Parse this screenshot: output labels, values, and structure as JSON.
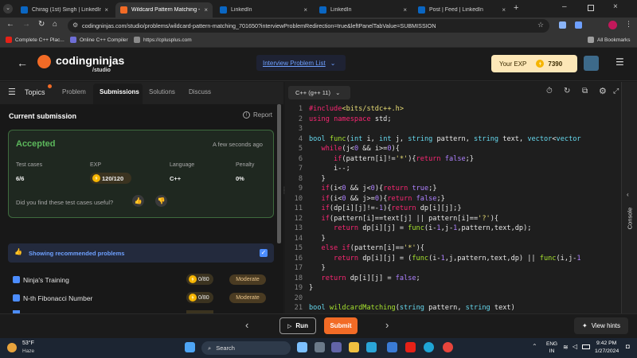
{
  "browser": {
    "tabs": [
      {
        "title": "Chirag (1st) Singh | LinkedIn",
        "active": false
      },
      {
        "title": "Wildcard Pattern Matching - Co",
        "active": true
      },
      {
        "title": "LinkedIn",
        "active": false
      },
      {
        "title": "LinkedIn",
        "active": false
      },
      {
        "title": "Post | Feed | LinkedIn",
        "active": false
      }
    ],
    "url": "codingninjas.com/studio/problems/wildcard-pattern-matching_701650?interviewProblemRedirection=true&leftPanelTabValue=SUBMISSION",
    "bookmarks": [
      "Complete C++ Plac...",
      "Online C++ Compiler",
      "https://cplusplus.com"
    ],
    "all_bookmarks": "All Bookmarks"
  },
  "header": {
    "logo_main": "codingninjas",
    "logo_sub": "/studio",
    "interview_list": "Interview Problem List",
    "exp_label": "Your EXP",
    "exp_value": "7390"
  },
  "left_tabs": {
    "topics": "Topics",
    "problem": "Problem",
    "submissions": "Submissions",
    "solutions": "Solutions",
    "discuss": "Discuss"
  },
  "submission": {
    "title": "Current submission",
    "report": "Report",
    "status": "Accepted",
    "time": "A few seconds ago",
    "test_cases_label": "Test cases",
    "test_cases_value": "6/6",
    "exp_label": "EXP",
    "exp_value": "120/120",
    "language_label": "Language",
    "language_value": "C++",
    "penalty_label": "Penalty",
    "penalty_value": "0%",
    "feedback_question": "Did you find these test cases useful?"
  },
  "recommended": {
    "label": "Showing recommended problems",
    "problems": [
      {
        "name": "Ninja's Training",
        "exp": "0/80",
        "difficulty": "Moderate"
      },
      {
        "name": "N-th Fibonacci Number",
        "exp": "0/80",
        "difficulty": "Moderate"
      }
    ]
  },
  "editor": {
    "language": "C++ (g++ 11)",
    "lines": [
      {
        "n": "1"
      },
      {
        "n": "2"
      },
      {
        "n": "3"
      },
      {
        "n": "4"
      },
      {
        "n": "5"
      },
      {
        "n": "6"
      },
      {
        "n": "7"
      },
      {
        "n": "8"
      },
      {
        "n": "9"
      },
      {
        "n": "10"
      },
      {
        "n": "11"
      },
      {
        "n": "12"
      },
      {
        "n": "13"
      },
      {
        "n": "14"
      },
      {
        "n": "15"
      },
      {
        "n": "16"
      },
      {
        "n": "17"
      },
      {
        "n": "18"
      },
      {
        "n": "19"
      },
      {
        "n": "20"
      },
      {
        "n": "21"
      }
    ],
    "console": "Console"
  },
  "actions": {
    "run": "Run",
    "submit": "Submit",
    "view_hints": "View hints"
  },
  "taskbar": {
    "weather_temp": "53°F",
    "weather_cond": "Haze",
    "search": "Search",
    "lang": "ENG",
    "region": "IN",
    "time": "9:42 PM",
    "date": "1/27/2024"
  },
  "colors": {
    "accent_orange": "#f26b26",
    "accepted_green": "#5cb85c",
    "link_blue": "#4c8dff"
  }
}
